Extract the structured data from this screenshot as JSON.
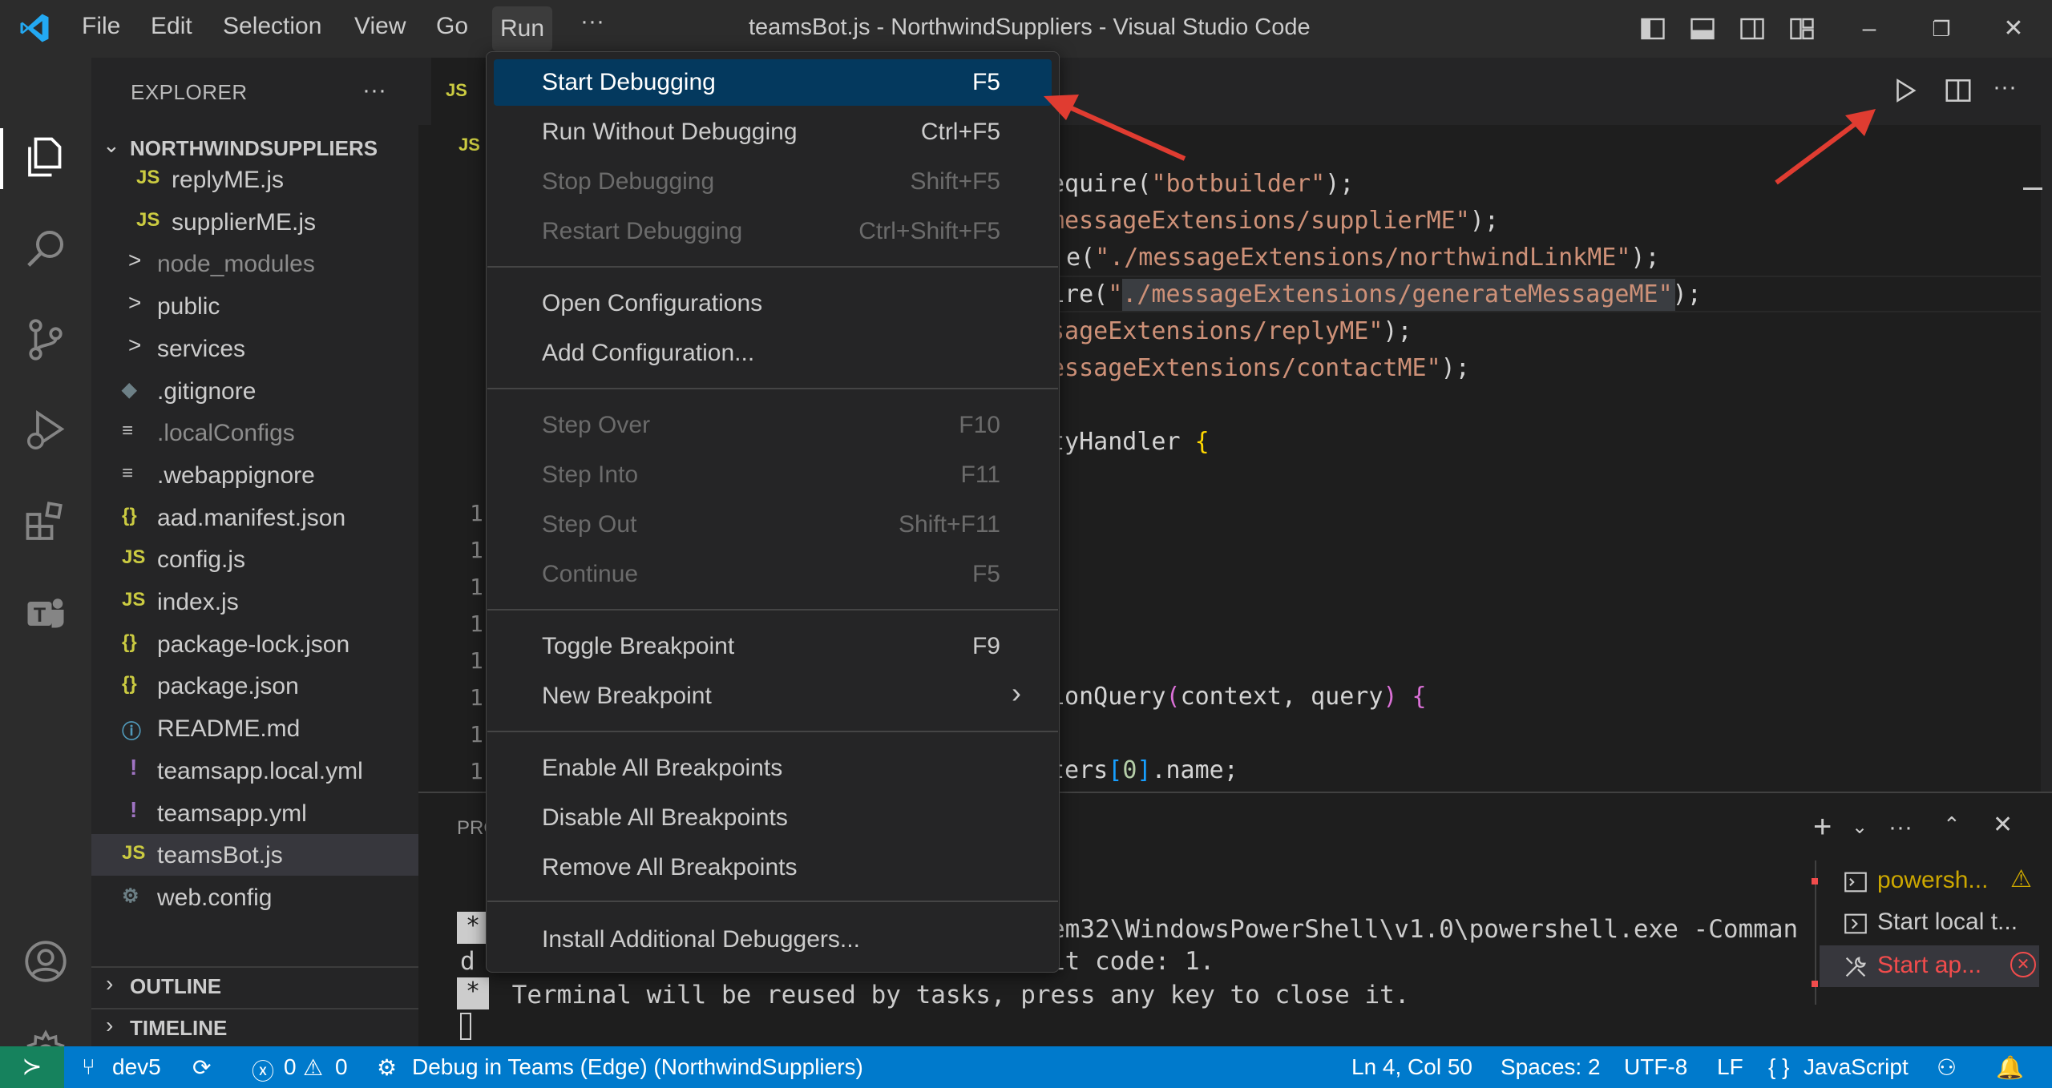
{
  "titlebar": {
    "menus": [
      "File",
      "Edit",
      "Selection",
      "View",
      "Go",
      "Run",
      "···"
    ],
    "title": "teamsBot.js - NorthwindSuppliers - Visual Studio Code"
  },
  "explorer": {
    "title": "EXPLORER",
    "more": "···",
    "root": "NORTHWINDSUPPLIERS",
    "items": [
      {
        "label": "replyME.js",
        "icon": "JS"
      },
      {
        "label": "supplierME.js",
        "icon": "JS"
      },
      {
        "label": "node_modules",
        "icon": ">"
      },
      {
        "label": "public",
        "icon": ">"
      },
      {
        "label": "services",
        "icon": ">"
      },
      {
        "label": ".gitignore",
        "icon": "◆"
      },
      {
        "label": ".localConfigs",
        "icon": "≡"
      },
      {
        "label": ".webappignore",
        "icon": "≡"
      },
      {
        "label": "aad.manifest.json",
        "icon": "{}"
      },
      {
        "label": "config.js",
        "icon": "JS"
      },
      {
        "label": "index.js",
        "icon": "JS"
      },
      {
        "label": "package-lock.json",
        "icon": "{}"
      },
      {
        "label": "package.json",
        "icon": "{}"
      },
      {
        "label": "README.md",
        "icon": "ⓘ"
      },
      {
        "label": "teamsapp.local.yml",
        "icon": "!"
      },
      {
        "label": "teamsapp.yml",
        "icon": "!"
      },
      {
        "label": "teamsBot.js",
        "icon": "JS"
      },
      {
        "label": "web.config",
        "icon": "⚙"
      }
    ],
    "outline": "OUTLINE",
    "timeline": "TIMELINE"
  },
  "editor": {
    "tab_icon": "JS",
    "breadcrumb_icon": "JS",
    "line_numbers": [
      "1",
      "1",
      "1",
      "1",
      "1",
      "1",
      "1",
      "1"
    ],
    "code": {
      "l1_a": "equire(",
      "l1_b": "\"botbuilder\"",
      "l1_c": ");",
      "l2_a": "messageExtensions/supplierME\"",
      "l2_b": ");",
      "l3_a": "e(",
      "l3_b": "\"./messageExtensions/northwindLinkME\"",
      "l3_c": ");",
      "l4_a": "ire(",
      "l4_b": "\"./messageExtensions/generateMessageME\"",
      "l4_c": ");",
      "l5_a": "sageExtensions/replyME\"",
      "l5_b": ");",
      "l6_a": "essageExtensions/contactME\"",
      "l6_b": ");",
      "l7_a": "tyHandler ",
      "l7_b": "{",
      "l8_a": "ionQuery",
      "l8_b": "(",
      "l8_c": "context, query",
      "l8_d": ")",
      "l8_e": " {",
      "l9_a": "ters",
      "l9_b": "[",
      "l9_c": "0",
      "l9_d": "]",
      "l9_e": ".name;"
    }
  },
  "panel": {
    "tab_label": "PRO",
    "terminal": {
      "line1": "em32\\WindowsPowerShell\\v1.0\\powershell.exe -Comman",
      "line2_prefix": "d",
      "line2": "it code: 1.",
      "line3": " Terminal will be reused by tasks, press any key to close it.",
      "star": "*"
    },
    "tasks": [
      {
        "label": "powersh...",
        "status": "warning"
      },
      {
        "label": "Start local t...",
        "status": "normal"
      },
      {
        "label": "Start ap...",
        "status": "error"
      }
    ]
  },
  "statusbar": {
    "branch": "dev5",
    "errors": "0",
    "warnings": "0",
    "debug": "Debug in Teams (Edge) (NorthwindSuppliers)",
    "position": "Ln 4, Col 50",
    "spaces": "Spaces: 2",
    "encoding": "UTF-8",
    "eol": "LF",
    "language": "JavaScript"
  },
  "run_menu": {
    "items": [
      {
        "label": "Start Debugging",
        "key": "F5",
        "state": "active"
      },
      {
        "label": "Run Without Debugging",
        "key": "Ctrl+F5",
        "state": "enabled"
      },
      {
        "label": "Stop Debugging",
        "key": "Shift+F5",
        "state": "disabled"
      },
      {
        "label": "Restart Debugging",
        "key": "Ctrl+Shift+F5",
        "state": "disabled"
      },
      {
        "label": "Open Configurations",
        "key": "",
        "state": "enabled"
      },
      {
        "label": "Add Configuration...",
        "key": "",
        "state": "enabled"
      },
      {
        "label": "Step Over",
        "key": "F10",
        "state": "disabled"
      },
      {
        "label": "Step Into",
        "key": "F11",
        "state": "disabled"
      },
      {
        "label": "Step Out",
        "key": "Shift+F11",
        "state": "disabled"
      },
      {
        "label": "Continue",
        "key": "F5",
        "state": "disabled"
      },
      {
        "label": "Toggle Breakpoint",
        "key": "F9",
        "state": "enabled"
      },
      {
        "label": "New Breakpoint",
        "key": "›",
        "state": "enabled"
      },
      {
        "label": "Enable All Breakpoints",
        "key": "",
        "state": "enabled"
      },
      {
        "label": "Disable All Breakpoints",
        "key": "",
        "state": "enabled"
      },
      {
        "label": "Remove All Breakpoints",
        "key": "",
        "state": "enabled"
      },
      {
        "label": "Install Additional Debuggers...",
        "key": "",
        "state": "enabled"
      }
    ]
  },
  "colors": {
    "accent": "#007acc",
    "annotation_arrow": "#e03c31",
    "menu_active": "#04395e"
  }
}
